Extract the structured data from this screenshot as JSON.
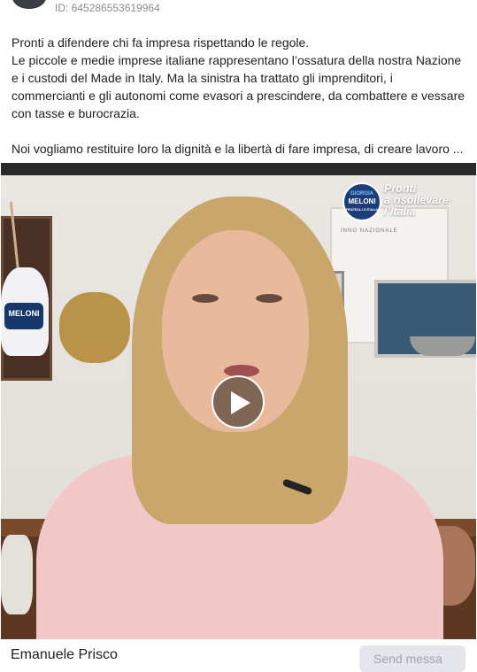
{
  "post": {
    "id_label": "ID: 645286553619964",
    "text_lines": [
      "Pronti a difendere chi fa impresa rispettando le regole.",
      "Le piccole e medie imprese italiane rappresentano l’ossatura della nostra Nazione e i custodi del Made in Italy. Ma la sinistra ha trattato gli imprenditori, i commercianti e gli autonomi come evasori a prescindere, da combattere e vessare con tasse e burocrazia.",
      "Noi vogliamo restituire loro la dignità e la libertà di fare impresa, di creare lavoro ..."
    ]
  },
  "video": {
    "brand_badge": {
      "line1": "GIORGIA",
      "line2": "MELONI",
      "line3": "FRATELLI D'ITALIA"
    },
    "brand_text": [
      "Pronti",
      "a risollevare",
      "l’Italia"
    ],
    "vase_label": "MELONI",
    "poster_text": "INNO NAZIONALE",
    "play_icon": "play-icon"
  },
  "footer": {
    "author": "Emanuele Prisco",
    "send_label": "Send messa"
  }
}
